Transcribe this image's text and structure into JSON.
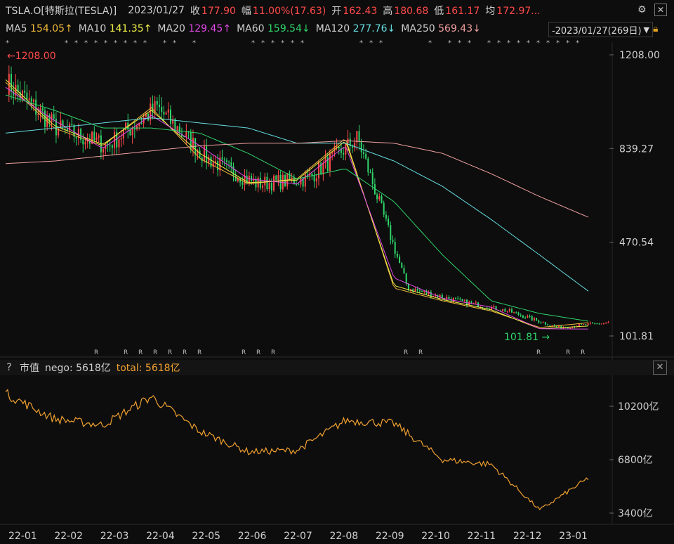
{
  "header": {
    "symbol": "TSLA.O[特斯拉(TESLA)]",
    "date": "2023/01/27",
    "close_label": "收",
    "close": "177.90",
    "range_label": "幅",
    "range": "11.00%(17.63)",
    "open_label": "开",
    "open": "162.43",
    "high_label": "高",
    "high": "180.68",
    "low_label": "低",
    "low": "161.17",
    "avg_label": "均",
    "avg": "172.97..."
  },
  "ma_bar": {
    "ma5": "MA5",
    "ma5_val": "154.05↑",
    "ma10": "MA10",
    "ma10_val": "141.35↑",
    "ma20": "MA20",
    "ma20_val": "129.45↑",
    "ma60": "MA60",
    "ma60_val": "159.54↓",
    "ma120": "MA120",
    "ma120_val": "277.76↓",
    "ma250": "MA250",
    "ma250_val": "569.43↓",
    "period": "-2023/01/27(269日)"
  },
  "icons": {
    "settings": "gear-icon",
    "close": "close-icon",
    "dropdown": "chevron-down-icon",
    "lock": "lock-icon"
  },
  "price_axis": [
    "1208.00",
    "839.27",
    "470.54",
    "101.81"
  ],
  "annotations": {
    "high_marker": "1208.00",
    "low_marker": "101.81"
  },
  "sub_panel": {
    "help": "?",
    "indicator": "市值",
    "nego_label": "nego: 5618亿",
    "total_label": "total: 5618亿",
    "close_glyph": "✕"
  },
  "cap_axis": [
    "10200亿",
    "6800亿",
    "3400亿"
  ],
  "time_axis": [
    "22-01",
    "22-02",
    "22-03",
    "22-04",
    "22-05",
    "22-06",
    "22-07",
    "22-08",
    "22-09",
    "22-10",
    "22-11",
    "22-12",
    "23-01"
  ],
  "colors": {
    "up": "#ff4a4a",
    "down": "#2fd56a",
    "ma5": "#f0b93a",
    "ma10": "#f0f04a",
    "ma20": "#e04ae6",
    "ma60": "#2fd56a",
    "ma120": "#66dde0",
    "ma250": "#f0a0a0",
    "cap_line": "#f0a030"
  },
  "chart_data": {
    "type": "line",
    "x": [
      "22-01",
      "22-02",
      "22-03",
      "22-04",
      "22-05",
      "22-06",
      "22-07",
      "22-08",
      "22-09",
      "22-10",
      "22-11",
      "22-12",
      "23-01"
    ],
    "ylim": [
      101.81,
      1208.0
    ],
    "series": [
      {
        "name": "MA5",
        "values": [
          1100,
          920,
          850,
          1000,
          800,
          700,
          720,
          880,
          290,
          240,
          200,
          135,
          154
        ]
      },
      {
        "name": "MA10",
        "values": [
          1110,
          930,
          855,
          990,
          820,
          705,
          715,
          870,
          300,
          245,
          205,
          130,
          141
        ]
      },
      {
        "name": "MA20",
        "values": [
          1080,
          950,
          840,
          970,
          850,
          720,
          700,
          850,
          330,
          250,
          215,
          130,
          129
        ]
      },
      {
        "name": "MA60",
        "values": [
          1050,
          990,
          920,
          920,
          900,
          820,
          720,
          760,
          630,
          420,
          240,
          190,
          160
        ]
      },
      {
        "name": "MA120",
        "values": [
          900,
          920,
          940,
          960,
          940,
          920,
          860,
          860,
          790,
          690,
          560,
          420,
          278
        ]
      },
      {
        "name": "MA250",
        "values": [
          780,
          790,
          810,
          830,
          850,
          860,
          860,
          870,
          860,
          820,
          740,
          650,
          569
        ]
      }
    ]
  },
  "cap_chart": {
    "type": "line",
    "ylim": [
      3400,
      10200
    ],
    "values": [
      11000,
      9400,
      9000,
      10800,
      8600,
      7300,
      7400,
      9300,
      9100,
      6800,
      6500,
      3600,
      5618
    ]
  }
}
